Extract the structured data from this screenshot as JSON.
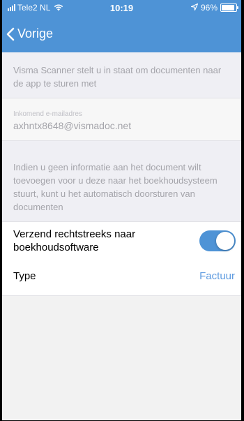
{
  "status_bar": {
    "carrier": "Tele2 NL",
    "time": "10:19",
    "battery_text": "96%",
    "battery_level": 0.96
  },
  "nav": {
    "back_label": "Vorige"
  },
  "intro_text": "Visma Scanner stelt u in staat om documenten naar de app te sturen met",
  "email": {
    "label": "Inkomend e-mailadres",
    "value": "axhntx8648@vismadoc.net"
  },
  "info_text": "Indien u geen informatie aan het document wilt toevoegen voor u deze naar het boekhoudsysteem stuurt, kunt u het automatisch doorsturen van documenten",
  "settings": {
    "send_direct": {
      "label": "Verzend rechtstreeks naar boekhoudsoftware",
      "enabled": true
    },
    "type": {
      "label": "Type",
      "value": "Factuur"
    }
  },
  "colors": {
    "accent": "#4e93d6",
    "link": "#5e9be0",
    "background": "#f2f2f2"
  }
}
